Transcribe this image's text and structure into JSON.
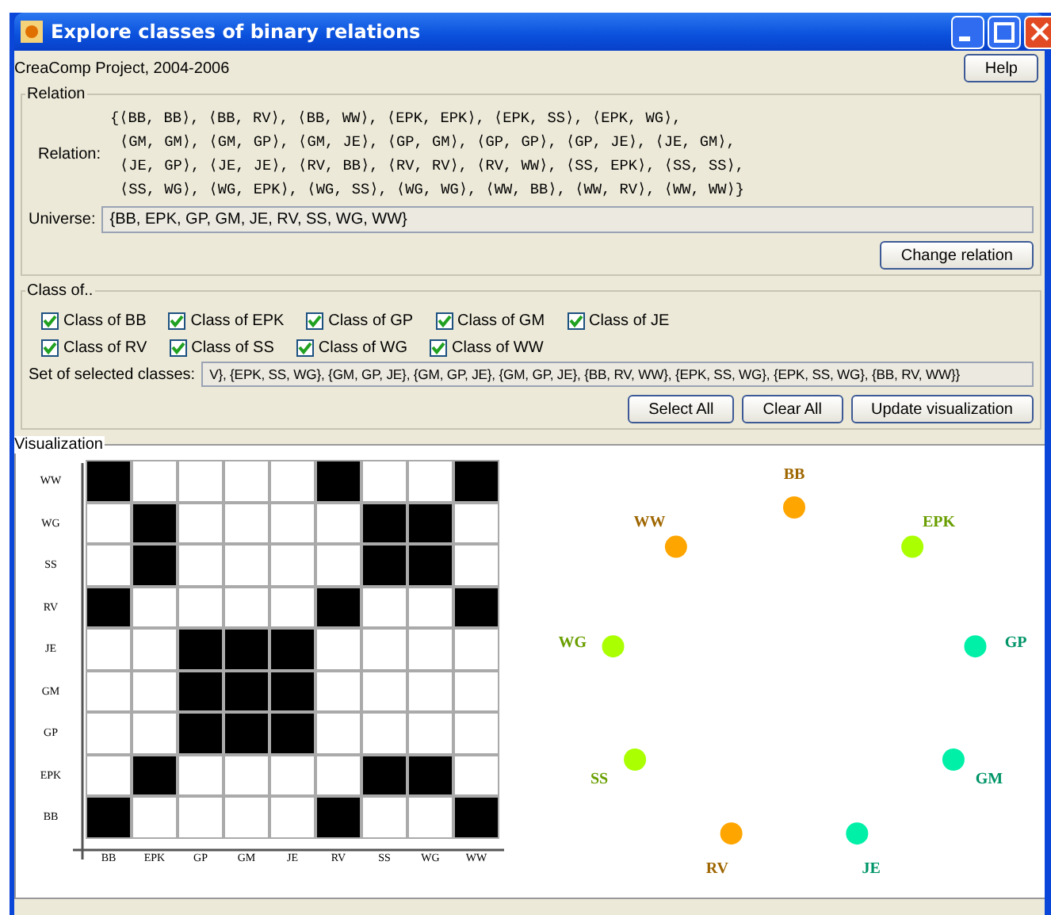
{
  "window": {
    "title": "Explore classes of binary relations"
  },
  "header": {
    "credit": "CreaComp Project, 2004-2006",
    "help_button": "Help"
  },
  "relation": {
    "legend": "Relation",
    "label": "Relation:",
    "lines": [
      "{⟨BB, BB⟩, ⟨BB, RV⟩, ⟨BB, WW⟩, ⟨EPK, EPK⟩, ⟨EPK, SS⟩, ⟨EPK, WG⟩,",
      "⟨GM, GM⟩, ⟨GM, GP⟩, ⟨GM, JE⟩, ⟨GP, GM⟩, ⟨GP, GP⟩, ⟨GP, JE⟩, ⟨JE, GM⟩,",
      "⟨JE, GP⟩, ⟨JE, JE⟩, ⟨RV, BB⟩, ⟨RV, RV⟩, ⟨RV, WW⟩, ⟨SS, EPK⟩, ⟨SS, SS⟩,",
      "⟨SS, WG⟩, ⟨WG, EPK⟩, ⟨WG, SS⟩, ⟨WG, WG⟩, ⟨WW, BB⟩, ⟨WW, RV⟩, ⟨WW, WW⟩}"
    ],
    "universe_label": "Universe:",
    "universe": "{BB, EPK, GP, GM, JE, RV, SS, WG, WW}",
    "change_button": "Change relation"
  },
  "classes": {
    "legend": "Class of..",
    "checkboxes": [
      [
        {
          "label": "Class of BB",
          "checked": true
        },
        {
          "label": "Class of EPK",
          "checked": true
        },
        {
          "label": "Class of GP",
          "checked": true
        },
        {
          "label": "Class of GM",
          "checked": true
        },
        {
          "label": "Class of JE",
          "checked": true
        }
      ],
      [
        {
          "label": "Class of RV",
          "checked": true
        },
        {
          "label": "Class of SS",
          "checked": true
        },
        {
          "label": "Class of WG",
          "checked": true
        },
        {
          "label": "Class of WW",
          "checked": true
        }
      ]
    ],
    "selected_label": "Set of selected classes:",
    "selected_value": "V}, {EPK, SS, WG}, {GM, GP, JE}, {GM, GP, JE}, {GM, GP, JE}, {BB, RV, WW}, {EPK, SS, WG}, {EPK, SS, WG}, {BB, RV, WW}}",
    "buttons": [
      "Select All",
      "Clear All",
      "Update visualization"
    ]
  },
  "visualization": {
    "legend": "Visualization",
    "matrix": {
      "columns": [
        "BB",
        "EPK",
        "GP",
        "GM",
        "JE",
        "RV",
        "SS",
        "WG",
        "WW"
      ],
      "rows": [
        {
          "label": "WW",
          "cells": [
            true,
            false,
            false,
            false,
            false,
            true,
            false,
            false,
            true
          ]
        },
        {
          "label": "WG",
          "cells": [
            false,
            true,
            false,
            false,
            false,
            false,
            true,
            true,
            false
          ]
        },
        {
          "label": "SS",
          "cells": [
            false,
            true,
            false,
            false,
            false,
            false,
            true,
            true,
            false
          ]
        },
        {
          "label": "RV",
          "cells": [
            true,
            false,
            false,
            false,
            false,
            true,
            false,
            false,
            true
          ]
        },
        {
          "label": "JE",
          "cells": [
            false,
            false,
            true,
            true,
            true,
            false,
            false,
            false,
            false
          ]
        },
        {
          "label": "GM",
          "cells": [
            false,
            false,
            true,
            true,
            true,
            false,
            false,
            false,
            false
          ]
        },
        {
          "label": "GP",
          "cells": [
            false,
            false,
            true,
            true,
            true,
            false,
            false,
            false,
            false
          ]
        },
        {
          "label": "EPK",
          "cells": [
            false,
            true,
            false,
            false,
            false,
            false,
            true,
            true,
            false
          ]
        },
        {
          "label": "BB",
          "cells": [
            true,
            false,
            false,
            false,
            false,
            true,
            false,
            false,
            true
          ]
        }
      ]
    },
    "graph": {
      "nodes": [
        {
          "label": "BB",
          "color": "#ffa500"
        },
        {
          "label": "EPK",
          "color": "#aaff00"
        },
        {
          "label": "GP",
          "color": "#00f0a8"
        },
        {
          "label": "GM",
          "color": "#00f0a8"
        },
        {
          "label": "JE",
          "color": "#00f0a8"
        },
        {
          "label": "RV",
          "color": "#ffa500"
        },
        {
          "label": "SS",
          "color": "#aaff00"
        },
        {
          "label": "WG",
          "color": "#aaff00"
        },
        {
          "label": "WW",
          "color": "#ffa500"
        }
      ]
    }
  }
}
